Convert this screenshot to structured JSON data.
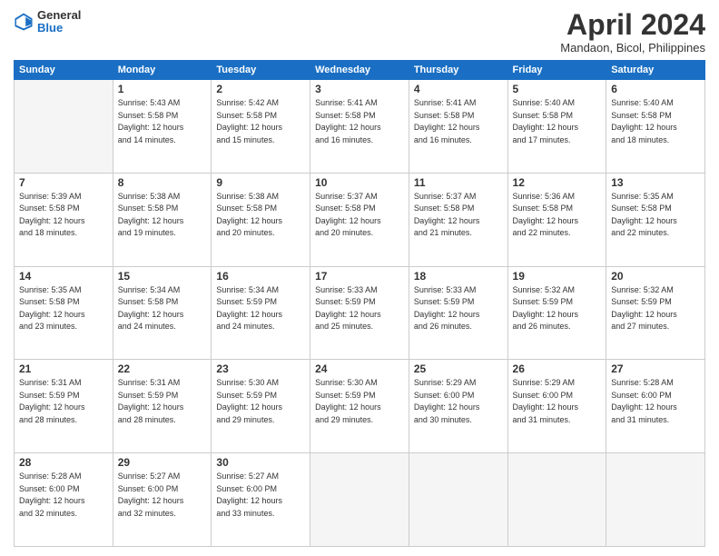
{
  "header": {
    "logo_general": "General",
    "logo_blue": "Blue",
    "month_title": "April 2024",
    "location": "Mandaon, Bicol, Philippines"
  },
  "weekdays": [
    "Sunday",
    "Monday",
    "Tuesday",
    "Wednesday",
    "Thursday",
    "Friday",
    "Saturday"
  ],
  "weeks": [
    [
      {
        "day": "",
        "info": ""
      },
      {
        "day": "1",
        "info": "Sunrise: 5:43 AM\nSunset: 5:58 PM\nDaylight: 12 hours\nand 14 minutes."
      },
      {
        "day": "2",
        "info": "Sunrise: 5:42 AM\nSunset: 5:58 PM\nDaylight: 12 hours\nand 15 minutes."
      },
      {
        "day": "3",
        "info": "Sunrise: 5:41 AM\nSunset: 5:58 PM\nDaylight: 12 hours\nand 16 minutes."
      },
      {
        "day": "4",
        "info": "Sunrise: 5:41 AM\nSunset: 5:58 PM\nDaylight: 12 hours\nand 16 minutes."
      },
      {
        "day": "5",
        "info": "Sunrise: 5:40 AM\nSunset: 5:58 PM\nDaylight: 12 hours\nand 17 minutes."
      },
      {
        "day": "6",
        "info": "Sunrise: 5:40 AM\nSunset: 5:58 PM\nDaylight: 12 hours\nand 18 minutes."
      }
    ],
    [
      {
        "day": "7",
        "info": "Sunrise: 5:39 AM\nSunset: 5:58 PM\nDaylight: 12 hours\nand 18 minutes."
      },
      {
        "day": "8",
        "info": "Sunrise: 5:38 AM\nSunset: 5:58 PM\nDaylight: 12 hours\nand 19 minutes."
      },
      {
        "day": "9",
        "info": "Sunrise: 5:38 AM\nSunset: 5:58 PM\nDaylight: 12 hours\nand 20 minutes."
      },
      {
        "day": "10",
        "info": "Sunrise: 5:37 AM\nSunset: 5:58 PM\nDaylight: 12 hours\nand 20 minutes."
      },
      {
        "day": "11",
        "info": "Sunrise: 5:37 AM\nSunset: 5:58 PM\nDaylight: 12 hours\nand 21 minutes."
      },
      {
        "day": "12",
        "info": "Sunrise: 5:36 AM\nSunset: 5:58 PM\nDaylight: 12 hours\nand 22 minutes."
      },
      {
        "day": "13",
        "info": "Sunrise: 5:35 AM\nSunset: 5:58 PM\nDaylight: 12 hours\nand 22 minutes."
      }
    ],
    [
      {
        "day": "14",
        "info": "Sunrise: 5:35 AM\nSunset: 5:58 PM\nDaylight: 12 hours\nand 23 minutes."
      },
      {
        "day": "15",
        "info": "Sunrise: 5:34 AM\nSunset: 5:58 PM\nDaylight: 12 hours\nand 24 minutes."
      },
      {
        "day": "16",
        "info": "Sunrise: 5:34 AM\nSunset: 5:59 PM\nDaylight: 12 hours\nand 24 minutes."
      },
      {
        "day": "17",
        "info": "Sunrise: 5:33 AM\nSunset: 5:59 PM\nDaylight: 12 hours\nand 25 minutes."
      },
      {
        "day": "18",
        "info": "Sunrise: 5:33 AM\nSunset: 5:59 PM\nDaylight: 12 hours\nand 26 minutes."
      },
      {
        "day": "19",
        "info": "Sunrise: 5:32 AM\nSunset: 5:59 PM\nDaylight: 12 hours\nand 26 minutes."
      },
      {
        "day": "20",
        "info": "Sunrise: 5:32 AM\nSunset: 5:59 PM\nDaylight: 12 hours\nand 27 minutes."
      }
    ],
    [
      {
        "day": "21",
        "info": "Sunrise: 5:31 AM\nSunset: 5:59 PM\nDaylight: 12 hours\nand 28 minutes."
      },
      {
        "day": "22",
        "info": "Sunrise: 5:31 AM\nSunset: 5:59 PM\nDaylight: 12 hours\nand 28 minutes."
      },
      {
        "day": "23",
        "info": "Sunrise: 5:30 AM\nSunset: 5:59 PM\nDaylight: 12 hours\nand 29 minutes."
      },
      {
        "day": "24",
        "info": "Sunrise: 5:30 AM\nSunset: 5:59 PM\nDaylight: 12 hours\nand 29 minutes."
      },
      {
        "day": "25",
        "info": "Sunrise: 5:29 AM\nSunset: 6:00 PM\nDaylight: 12 hours\nand 30 minutes."
      },
      {
        "day": "26",
        "info": "Sunrise: 5:29 AM\nSunset: 6:00 PM\nDaylight: 12 hours\nand 31 minutes."
      },
      {
        "day": "27",
        "info": "Sunrise: 5:28 AM\nSunset: 6:00 PM\nDaylight: 12 hours\nand 31 minutes."
      }
    ],
    [
      {
        "day": "28",
        "info": "Sunrise: 5:28 AM\nSunset: 6:00 PM\nDaylight: 12 hours\nand 32 minutes."
      },
      {
        "day": "29",
        "info": "Sunrise: 5:27 AM\nSunset: 6:00 PM\nDaylight: 12 hours\nand 32 minutes."
      },
      {
        "day": "30",
        "info": "Sunrise: 5:27 AM\nSunset: 6:00 PM\nDaylight: 12 hours\nand 33 minutes."
      },
      {
        "day": "",
        "info": ""
      },
      {
        "day": "",
        "info": ""
      },
      {
        "day": "",
        "info": ""
      },
      {
        "day": "",
        "info": ""
      }
    ]
  ]
}
